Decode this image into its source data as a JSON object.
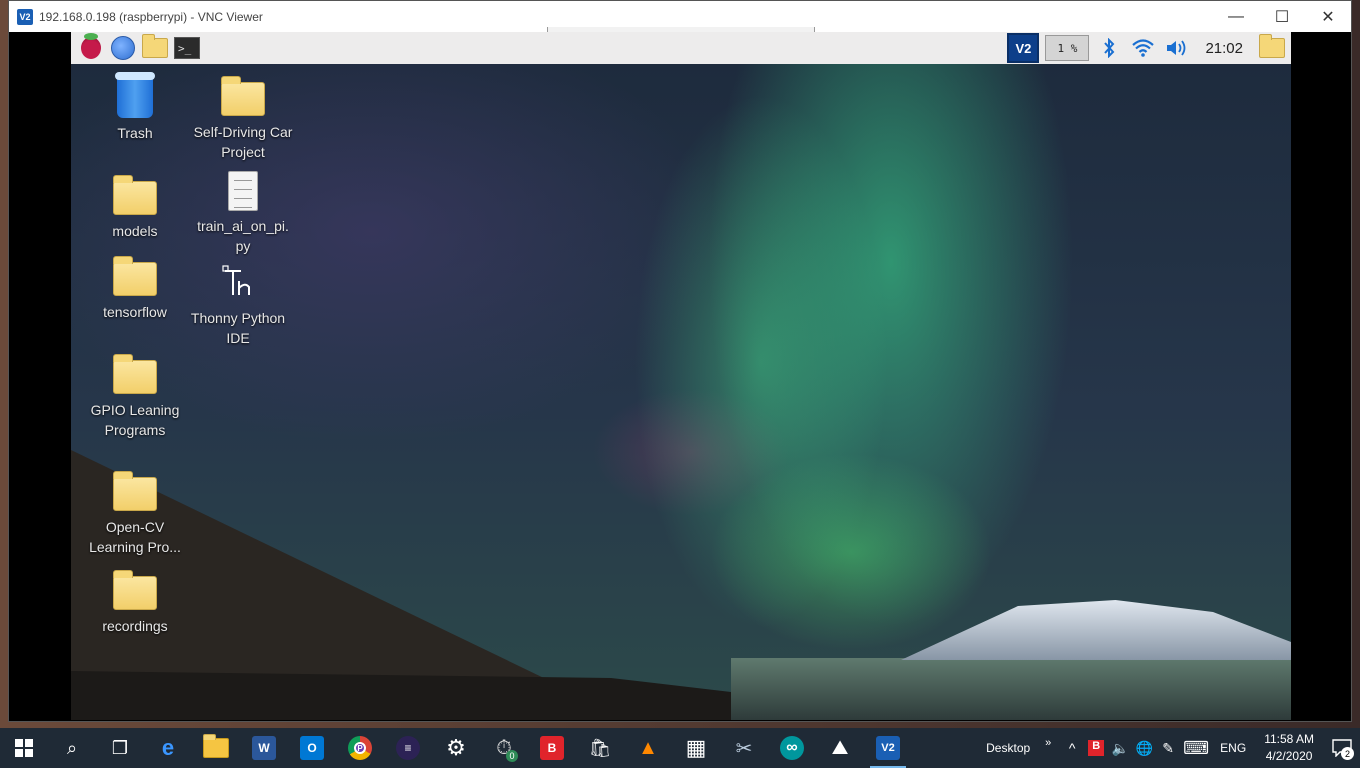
{
  "vnc": {
    "title": "192.168.0.198 (raspberrypi) - VNC Viewer",
    "app_icon": "V2",
    "controls": {
      "minimize": "—",
      "maximize": "☐",
      "close": "✕"
    }
  },
  "rpi_panel": {
    "launchers": [
      {
        "icon": "raspberry-menu-icon"
      },
      {
        "icon": "web-browser-globe-icon"
      },
      {
        "icon": "file-manager-folder-icon"
      },
      {
        "icon": "terminal-icon",
        "text": ">_"
      }
    ],
    "vnc_tray_text": "V2",
    "cpu_usage": "1 %",
    "bluetooth_icon": "bluetooth-icon",
    "wifi_icon": "wifi-icon",
    "volume_icon": "volume-icon",
    "clock": "21:02",
    "ejecter_icon": "folder-icon"
  },
  "desktop": {
    "icons": [
      {
        "label": "Trash",
        "type": "trash"
      },
      {
        "label": "Self-Driving Car Project",
        "type": "folder"
      },
      {
        "label": "models",
        "type": "folder"
      },
      {
        "label": "train_ai_on_pi.py",
        "type": "file"
      },
      {
        "label": "tensorflow",
        "type": "folder"
      },
      {
        "label": "Thonny Python IDE",
        "type": "app"
      },
      {
        "label": "GPIO Leaning Programs",
        "type": "folder"
      },
      {
        "label": "Open-CV Learning Pro...",
        "type": "folder"
      },
      {
        "label": "recordings",
        "type": "folder"
      }
    ]
  },
  "taskbar": {
    "apps": [
      {
        "name": "start",
        "icon": "windows-logo-icon"
      },
      {
        "name": "search",
        "icon": "search-icon",
        "glyph": "⌕"
      },
      {
        "name": "task-view",
        "icon": "task-view-icon",
        "glyph": "❐"
      },
      {
        "name": "edge",
        "icon": "edge-icon",
        "glyph": "e",
        "color": "#1e90ff"
      },
      {
        "name": "file-explorer",
        "icon": "file-explorer-icon",
        "glyph": "",
        "color": "#f5c542"
      },
      {
        "name": "word",
        "icon": "word-icon",
        "glyph": "W",
        "color": "#2b579a"
      },
      {
        "name": "outlook",
        "icon": "outlook-icon",
        "glyph": "O",
        "color": "#0078d4"
      },
      {
        "name": "chrome",
        "icon": "chrome-icon",
        "glyph": "P",
        "color": "#db4437"
      },
      {
        "name": "eclipse",
        "icon": "eclipse-icon",
        "glyph": "≡",
        "color": "#2c2255"
      },
      {
        "name": "settings",
        "icon": "gear-icon",
        "glyph": "⚙",
        "color": "transparent"
      },
      {
        "name": "clock-app",
        "icon": "alarm-clock-icon",
        "glyph": "⏱",
        "color": "transparent",
        "badge": "0"
      },
      {
        "name": "b-app",
        "icon": "b-app-icon",
        "glyph": "B",
        "color": "#e0242b"
      },
      {
        "name": "store",
        "icon": "store-bag-icon",
        "glyph": "🛍",
        "color": "transparent"
      },
      {
        "name": "vlc",
        "icon": "vlc-cone-icon",
        "glyph": "▲",
        "color": "transparent"
      },
      {
        "name": "calculator",
        "icon": "calculator-icon",
        "glyph": "▦",
        "color": "transparent"
      },
      {
        "name": "snipping",
        "icon": "snipping-tool-icon",
        "glyph": "✂",
        "color": "transparent"
      },
      {
        "name": "arduino",
        "icon": "arduino-icon",
        "glyph": "∞",
        "color": "#00979d"
      },
      {
        "name": "photos",
        "icon": "photos-icon",
        "glyph": "⛰",
        "color": "transparent"
      },
      {
        "name": "vnc-viewer",
        "icon": "vnc-viewer-icon",
        "glyph": "V2",
        "color": "#1a5fb4",
        "active": true
      }
    ],
    "desktop_label": "Desktop",
    "tray": {
      "chevron_glyph": "»",
      "show_hidden_glyph": "^",
      "volume_glyph": "🔈",
      "network_glyph": "🌐",
      "pen_glyph": "✎",
      "keyboard_glyph": "⌨",
      "b_tray_glyph": "B"
    },
    "language": "ENG",
    "time": "11:58 AM",
    "date": "4/2/2020",
    "notification_count": "2"
  }
}
